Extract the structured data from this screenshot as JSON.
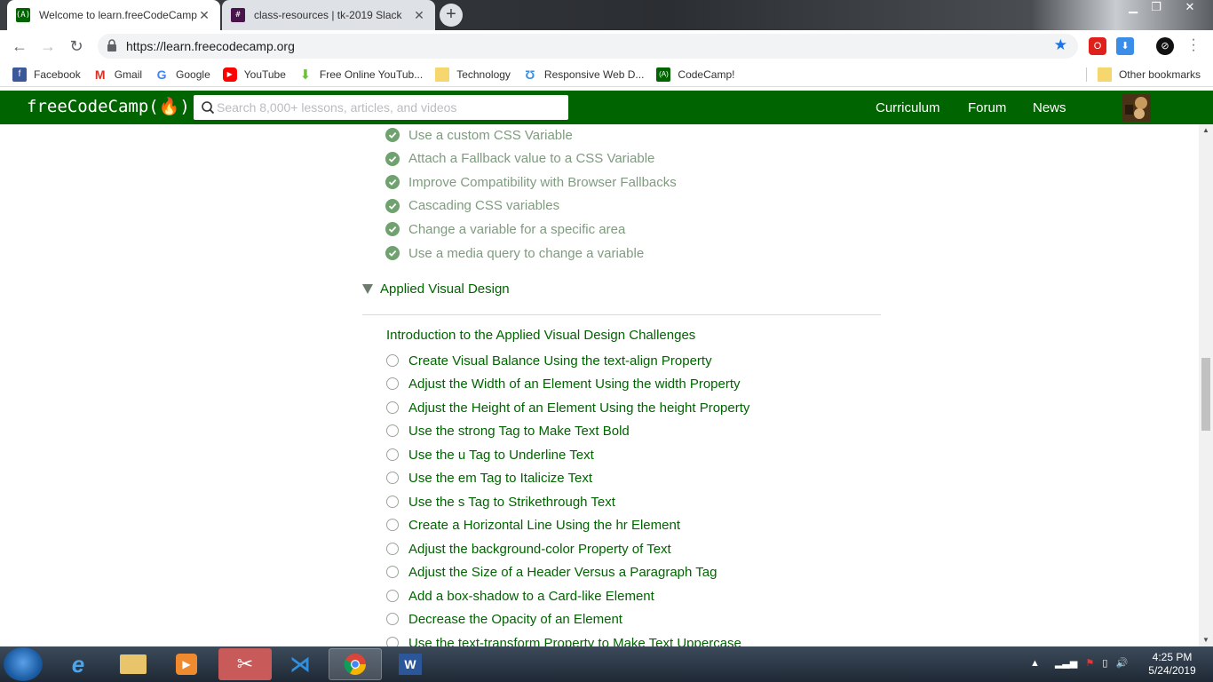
{
  "browser": {
    "tabs": [
      {
        "title": "Welcome to learn.freeCodeCamp",
        "active": true
      },
      {
        "title": "class-resources | tk-2019 Slack",
        "active": false
      }
    ],
    "new_tab_symbol": "+",
    "url": "https://learn.freecodecamp.org",
    "bookmarks": [
      {
        "label": "Facebook",
        "icon": "facebook-icon"
      },
      {
        "label": "Gmail",
        "icon": "gmail-icon"
      },
      {
        "label": "Google",
        "icon": "google-icon"
      },
      {
        "label": "YouTube",
        "icon": "youtube-icon"
      },
      {
        "label": "Free Online YouTub...",
        "icon": "download-arrow-icon"
      },
      {
        "label": "Technology",
        "icon": "folder-icon"
      },
      {
        "label": "Responsive Web D...",
        "icon": "responsive-icon"
      },
      {
        "label": "CodeCamp!",
        "icon": "fcc-icon"
      }
    ],
    "other_bookmarks": "Other bookmarks"
  },
  "fcc": {
    "logo": "freeCodeCamp(🔥)",
    "search_placeholder": "Search 8,000+ lessons, articles, and videos",
    "nav": [
      "Curriculum",
      "Forum",
      "News"
    ],
    "brand_color": "#006400"
  },
  "completed": [
    "Use a custom CSS Variable",
    "Attach a Fallback value to a CSS Variable",
    "Improve Compatibility with Browser Fallbacks",
    "Cascading CSS variables",
    "Change a variable for a specific area",
    "Use a media query to change a variable"
  ],
  "section": {
    "title": "Applied Visual Design",
    "intro": "Introduction to the Applied Visual Design Challenges",
    "challenges": [
      "Create Visual Balance Using the text-align Property",
      "Adjust the Width of an Element Using the width Property",
      "Adjust the Height of an Element Using the height Property",
      "Use the strong Tag to Make Text Bold",
      "Use the u Tag to Underline Text",
      "Use the em Tag to Italicize Text",
      "Use the s Tag to Strikethrough Text",
      "Create a Horizontal Line Using the hr Element",
      "Adjust the background-color Property of Text",
      "Adjust the Size of a Header Versus a Paragraph Tag",
      "Add a box-shadow to a Card-like Element",
      "Decrease the Opacity of an Element",
      "Use the text-transform Property to Make Text Uppercase"
    ]
  },
  "taskbar": {
    "time": "4:25 PM",
    "date": "5/24/2019"
  }
}
